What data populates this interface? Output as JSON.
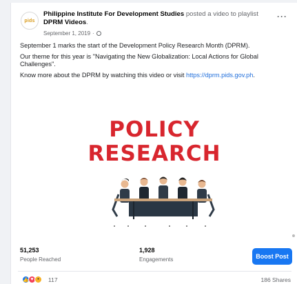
{
  "post": {
    "logo_text": "pids",
    "author": "Philippine Institute For Development Studies",
    "action": " posted a video to playlist ",
    "playlist": "DPRM Videos",
    "date": "September 1, 2019",
    "separator": "·",
    "privacy_icon": "globe-icon",
    "more_icon": "more-options-icon",
    "more_label": "···",
    "paragraphs": {
      "p1": "September 1 marks the start of the Development Policy Research Month (DPRM).",
      "p2": "Our theme for this year is \"Navigating the New Globalization: Local Actions for Global Challenges\".",
      "p3_prefix": "Know more about the DPRM by watching this video or visit ",
      "p3_link": "https://dprm.pids.gov.ph",
      "p3_suffix": "."
    }
  },
  "media": {
    "line1": "POLICY",
    "line2": "RESEARCH",
    "title_color": "#d8262e"
  },
  "stats": {
    "reached_value": "51,253",
    "reached_label": "People Reached",
    "engagements_value": "1,928",
    "engagements_label": "Engagements",
    "boost_label": "Boost Post"
  },
  "reactions": {
    "icons": [
      "like-icon",
      "love-icon",
      "wow-icon"
    ],
    "count": "117",
    "shares": "186 Shares"
  },
  "colors": {
    "accent": "#1877f2",
    "link": "#216fdb",
    "secondary_text": "#65676b"
  }
}
